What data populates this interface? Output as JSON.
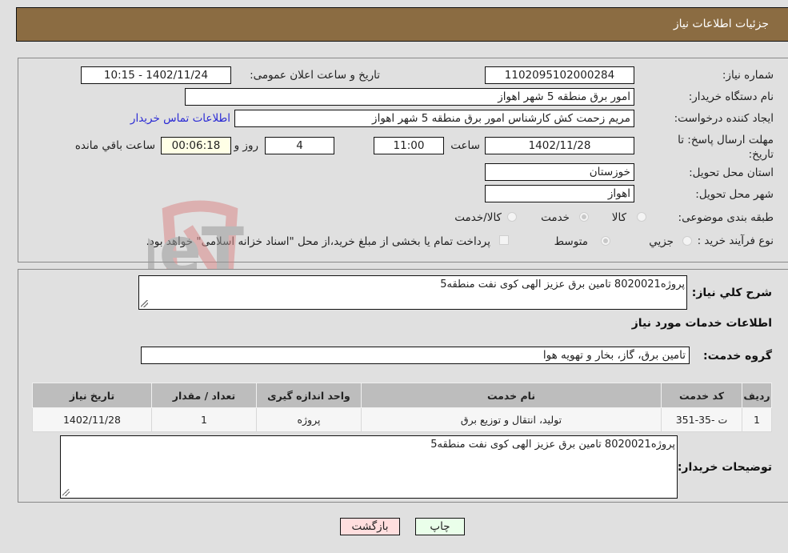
{
  "header": {
    "title": "جزئیات اطلاعات نیاز"
  },
  "fields": {
    "need_number": {
      "label": "شماره نیاز:",
      "value": "1102095102000284"
    },
    "announce_datetime": {
      "label": "تاریخ و ساعت اعلان عمومی:",
      "value": "1402/11/24 - 10:15"
    },
    "buyer_org": {
      "label": "نام دستگاه خریدار:",
      "value": "امور برق منطقه 5 شهر اهواز"
    },
    "requester": {
      "label": "ایجاد کننده درخواست:",
      "value": "مریم زحمت کش کارشناس امور برق منطقه 5 شهر اهواز"
    },
    "buyer_contact_link": "اطلاعات تماس خریدار",
    "deadline": {
      "label": "مهلت ارسال پاسخ: تا تاریخ:",
      "date": "1402/11/28",
      "time_label": "ساعت",
      "time": "11:00",
      "days": "4",
      "days_label": "روز و",
      "remaining": "00:06:18",
      "remaining_label": "ساعت باقي مانده"
    },
    "province": {
      "label": "استان محل تحویل:",
      "value": "خوزستان"
    },
    "city": {
      "label": "شهر محل تحویل:",
      "value": "اهواز"
    },
    "category": {
      "label": "طبقه بندی موضوعی:",
      "options": [
        "کالا",
        "خدمت",
        "کالا/خدمت"
      ],
      "selected": "خدمت"
    },
    "purchase_type": {
      "label": "نوع فرآیند خرید :",
      "options": [
        "جزيي",
        "متوسط"
      ],
      "selected": "متوسط",
      "treasury_note": "پرداخت تمام یا بخشی از مبلغ خرید،از محل \"اسناد خزانه اسلامی\" خواهد بود."
    }
  },
  "description": {
    "label": "شرح کلي نياز:",
    "value": "پروژه8020021 تامین برق عزیز الهی کوی نفت منطقه5"
  },
  "services_info_title": "اطلاعات خدمات مورد نیاز",
  "service_group": {
    "label": "گروه خدمت:",
    "value": "تامین برق، گاز، بخار و تهویه هوا"
  },
  "table": {
    "columns": [
      "ردیف",
      "کد خدمت",
      "نام خدمت",
      "واحد اندازه گیری",
      "تعداد / مقدار",
      "تاریخ نیاز"
    ],
    "rows": [
      [
        "1",
        "ت -35-351",
        "تولید، انتقال و توزیع برق",
        "پروژه",
        "1",
        "1402/11/28"
      ]
    ]
  },
  "buyer_notes": {
    "label": "توضیحات خریدار:",
    "value": "پروژه8020021 تامین برق عزیز الهی کوی نفت منطقه5"
  },
  "buttons": {
    "print": "چاپ",
    "back": "بازگشت"
  },
  "watermark": "AriaTender.neT",
  "colors": {
    "header_bg": "#8b6c42",
    "link": "#2a2ad4",
    "print_bg": "#eaffea",
    "back_bg": "#ffdede",
    "remaining_bg": "#ffffe6"
  }
}
